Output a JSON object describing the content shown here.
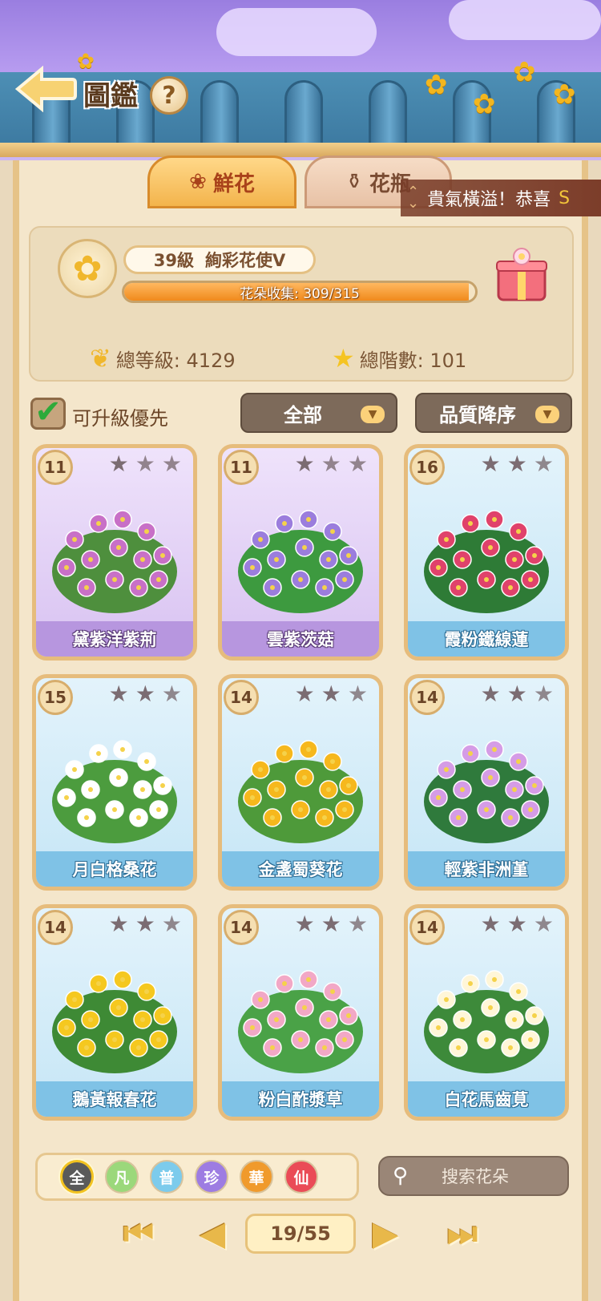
{
  "header": {
    "title": "圖鑑",
    "help_symbol": "?"
  },
  "tabs": [
    {
      "label": "鮮花",
      "icon": "rose-icon",
      "active": true
    },
    {
      "label": "花瓶",
      "icon": "vase-icon",
      "active": false
    }
  ],
  "ticker": {
    "text": "貴氣橫溢！恭喜",
    "tail": "S"
  },
  "profile": {
    "level": "39級",
    "rank": "絢彩花使V",
    "collection_label": "花朵收集: 309/315",
    "collection_fraction": 0.981,
    "total_level": "總等級: 4129",
    "total_stars": "總階數: 101"
  },
  "filters": {
    "upgrade_first": "可升級優先",
    "category": "全部",
    "sort": "品質降序"
  },
  "cards": [
    {
      "level": "11",
      "name": "黛紫洋紫荊",
      "theme": "purple",
      "stars_on": 1
    },
    {
      "level": "11",
      "name": "雲紫茨菇",
      "theme": "purple",
      "stars_on": 1
    },
    {
      "level": "16",
      "name": "霞粉鐵線蓮",
      "theme": "blue",
      "stars_on": 2
    },
    {
      "level": "15",
      "name": "月白格桑花",
      "theme": "blue",
      "stars_on": 2
    },
    {
      "level": "14",
      "name": "金盞蜀葵花",
      "theme": "blue",
      "stars_on": 2
    },
    {
      "level": "14",
      "name": "輕紫非洲堇",
      "theme": "blue",
      "stars_on": 2
    },
    {
      "level": "14",
      "name": "鵝黃報春花",
      "theme": "blue",
      "stars_on": 2
    },
    {
      "level": "14",
      "name": "粉白酢漿草",
      "theme": "blue",
      "stars_on": 2
    },
    {
      "level": "14",
      "name": "白花馬齒莧",
      "theme": "blue",
      "stars_on": 2
    }
  ],
  "quality": [
    {
      "label": "全",
      "color": "#5a5a5a",
      "selected": true
    },
    {
      "label": "凡",
      "color": "#9bd87b"
    },
    {
      "label": "普",
      "color": "#7ccbec"
    },
    {
      "label": "珍",
      "color": "#9d7ce2"
    },
    {
      "label": "華",
      "color": "#f09a2c"
    },
    {
      "label": "仙",
      "color": "#ea4b57"
    }
  ],
  "search": {
    "placeholder": "搜索花朵"
  },
  "pager": {
    "page": "19/55"
  },
  "colors": {
    "accent": "#f3b44c",
    "panel": "#f4e6cb",
    "brand_purple": "#b796df",
    "brand_blue": "#7fc2e6"
  }
}
